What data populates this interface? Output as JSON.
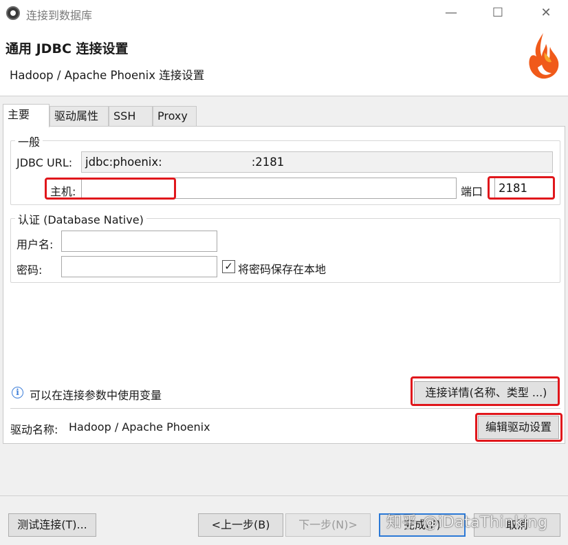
{
  "window": {
    "title": "连接到数据库",
    "minimize": "—",
    "maximize": "☐",
    "close": "✕"
  },
  "header": {
    "title": "通用 JDBC 连接设置",
    "subtitle": "Hadoop / Apache Phoenix 连接设置"
  },
  "tabs": [
    {
      "label": "主要",
      "active": true
    },
    {
      "label": "驱动属性",
      "active": false
    },
    {
      "label": "SSH",
      "active": false
    },
    {
      "label": "Proxy",
      "active": false
    }
  ],
  "general": {
    "legend": "一般",
    "jdbc_url_label": "JDBC URL:",
    "jdbc_url_value": "jdbc:phoenix:",
    "jdbc_url_suffix": ":2181",
    "host_label": "主机:",
    "port_label": "端口",
    "port_value": "2181"
  },
  "auth": {
    "legend": "认证 (Database Native)",
    "username_label": "用户名:",
    "username_value": "",
    "password_label": "密码:",
    "password_value": "",
    "save_password_label": "将密码保存在本地",
    "save_password_checked": true
  },
  "info": {
    "icon": "info-icon",
    "text": "可以在连接参数中使用变量",
    "details_button": "连接详情(名称、类型 ...)"
  },
  "driver": {
    "label": "驱动名称:",
    "name": "Hadoop / Apache Phoenix",
    "edit_button": "编辑驱动设置"
  },
  "footer": {
    "test_button": "测试连接(T)...",
    "back_button": "<上一步(B)",
    "next_button": "下一步(N)>",
    "finish_button": "完成(F)",
    "cancel_button": "取消"
  },
  "watermark": "知乎 @iDataThinking",
  "colors": {
    "highlight": "#e0161b",
    "default_button_border": "#2a78d6",
    "info_icon": "#3b7dd8"
  }
}
